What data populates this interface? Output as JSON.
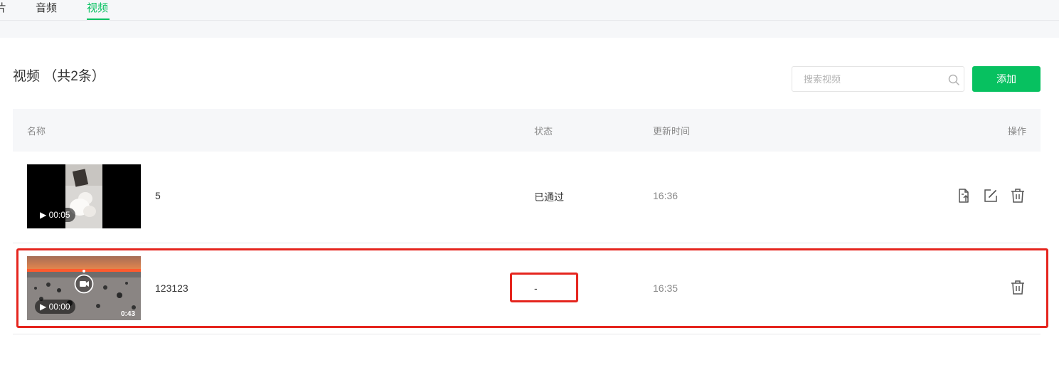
{
  "tabs": [
    {
      "label": "片",
      "active": false
    },
    {
      "label": "音频",
      "active": false
    },
    {
      "label": "视频",
      "active": true
    }
  ],
  "page": {
    "title": "视频 （共2条）",
    "search_placeholder": "搜索视频",
    "add_label": "添加"
  },
  "table": {
    "headers": {
      "name": "名称",
      "status": "状态",
      "time": "更新时间",
      "ops": "操作"
    },
    "rows": [
      {
        "name": "5",
        "status": "已通过",
        "time": "16:36",
        "duration": "▶ 00:05",
        "length_label": "",
        "actions": [
          "upload-icon",
          "edit-icon",
          "trash-icon"
        ]
      },
      {
        "name": "123123",
        "status": "-",
        "time": "16:35",
        "duration": "▶ 00:00",
        "length_label": "0:43",
        "actions": [
          "trash-icon"
        ]
      }
    ]
  },
  "colors": {
    "accent": "#07c160",
    "highlight": "#e5251e",
    "header_bg": "#f6f7f9"
  }
}
